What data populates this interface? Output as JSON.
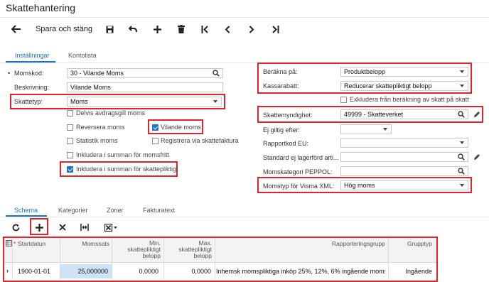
{
  "app_title": "Skattehantering",
  "toolbar": {
    "back_icon": "arrow-back-icon",
    "save_close_label": "Spara och stäng",
    "save_icon": "floppy-disk-icon",
    "undo_icon": "undo-icon",
    "add_icon": "plus-icon",
    "delete_icon": "trash-icon",
    "first_icon": "first-page-icon",
    "prev_icon": "chevron-left-icon",
    "next_icon": "chevron-right-icon",
    "last_icon": "last-page-icon"
  },
  "tabs": [
    "Inställningar",
    "Kontolista"
  ],
  "form": {
    "momskod_label": "Momskod:",
    "momskod_value": "30 - Vilande Moms",
    "beskrivning_label": "Beskrivning:",
    "beskrivning_value": "Vilande Moms",
    "skattetyp_label": "Skattetyp:",
    "skattetyp_value": "Moms",
    "berakna_label": "Beräkna på:",
    "berakna_value": "Produktbelopp",
    "kassarabatt_label": "Kassarabatt:",
    "kassarabatt_value": "Reducerar skattepliktigt belopp",
    "exkludera_label": "Exkludera från beräkning av skatt på skatt",
    "skattemyndighet_label": "Skattemyndighet:",
    "skattemyndighet_value": "49999 - Skatteverket",
    "ej_giltig_label": "Ej giltig efter:",
    "ej_giltig_value": "",
    "rapportkod_label": "Rapportkod EU:",
    "rapportkod_value": "",
    "standard_label": "Standard ej lagerförd arti...",
    "standard_value": "",
    "momskategori_label": "Momskategori PEPPOL:",
    "momskategori_value": "",
    "momstyp_label": "Momstyp för Visma XML:",
    "momstyp_value": "Hög moms"
  },
  "checkboxes": {
    "delvis": {
      "label": "Delvis avdragsgill moms",
      "checked": false
    },
    "reversera": {
      "label": "Reversera moms",
      "checked": false
    },
    "vilande": {
      "label": "Vilande moms",
      "checked": true
    },
    "statistik": {
      "label": "Statistik moms",
      "checked": false
    },
    "registrera": {
      "label": "Registrera via skattefaktura",
      "checked": false
    },
    "inkl_fritt": {
      "label": "Inkludera i summan för momsfritt",
      "checked": false
    },
    "inkl_skatt": {
      "label": "Inkludera i summan för skattepliktigt",
      "checked": true
    }
  },
  "lower_tabs": [
    "Schema",
    "Kategorier",
    "Zoner",
    "Fakturatext"
  ],
  "grid_toolbar": {
    "refresh_icon": "refresh-icon",
    "add_icon": "plus-icon",
    "delete_icon": "close-icon",
    "fit_icon": "fit-columns-icon",
    "export_icon": "excel-export-icon"
  },
  "grid": {
    "headers": {
      "startdatum": "Startdatun",
      "startdatum_required": "*",
      "momssats": "Momssats",
      "min_line1": "Min.",
      "min_line2": "skattepliktigt",
      "min_line3": "belopp",
      "max_line1": "Max.",
      "max_line2": "skattepliktigt",
      "max_line3": "belopp",
      "rapporteringsgrupp": "Rapporteringsgrupp",
      "gruppptyp": "Grupptyp"
    },
    "rows": [
      {
        "startdatum": "1900-01-01",
        "momssats": "25,000000",
        "min": "0,0000",
        "max": "0,0000",
        "rapporteringsgrupp": "Inhemsk momspliktiga inköp 25%, 12%, 6% ingående moms",
        "grupptyp": "Ingående"
      }
    ]
  },
  "colors": {
    "accent": "#1a73c8",
    "highlight_red": "#e0242b",
    "selected_cell": "#cfe3f6"
  }
}
